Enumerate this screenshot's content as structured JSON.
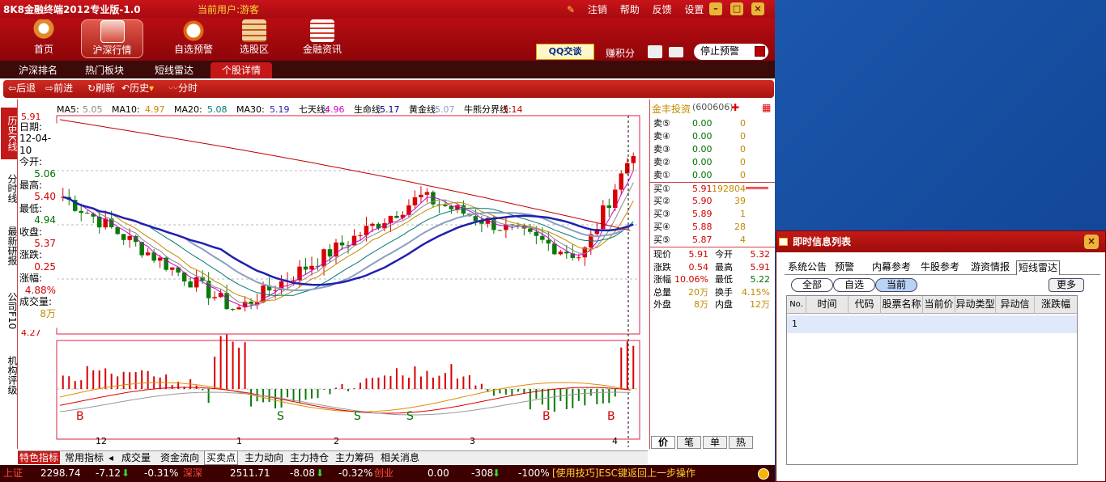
{
  "window": {
    "title": "8K8金融终端2012专业版-1.0",
    "user_label": "当前用户:游客",
    "menu": [
      "注销",
      "帮助",
      "反馈",
      "设置"
    ]
  },
  "toolbar": {
    "items": [
      "首页",
      "沪深行情",
      "自选预警",
      "选股区",
      "金融资讯"
    ],
    "qq_label": "QQ交谈",
    "points_label": "赚积分",
    "stop_alert_label": "停止预警"
  },
  "nav_tabs": [
    "沪深排名",
    "热门板块",
    "短线雷达",
    "个股详情"
  ],
  "sub_toolbar": [
    "后退",
    "前进",
    "刷新",
    "历史",
    "分时"
  ],
  "side_tabs": [
    "历史K线",
    "分时线",
    "最新研报",
    "公司F10",
    "机构评级"
  ],
  "ma_legend": [
    {
      "label": "MA5:",
      "value": "5.05",
      "color": "#888888"
    },
    {
      "label": "MA10:",
      "value": "4.97",
      "color": "#c28a00"
    },
    {
      "label": "MA20:",
      "value": "5.08",
      "color": "#007a6e"
    },
    {
      "label": "MA30:",
      "value": "5.19",
      "color": "#1f1fb0"
    },
    {
      "label": "七天线:",
      "value": "4.96",
      "color": "#d000d0"
    },
    {
      "label": "生命线:",
      "value": "5.17",
      "color": "#000080"
    },
    {
      "label": "黄金线:",
      "value": "5.07",
      "color": "#8aa0c0"
    },
    {
      "label": "牛熊分界线:",
      "value": "5.14",
      "color": "#c00000"
    }
  ],
  "price_axis": {
    "top": "5.91",
    "bottom": "4.27"
  },
  "info_box": [
    {
      "label": "日期:",
      "value": "12-04-10"
    },
    {
      "label": "今开:",
      "value": "5.06"
    },
    {
      "label": "最高:",
      "value": "5.40"
    },
    {
      "label": "最低:",
      "value": "4.94"
    },
    {
      "label": "收盘:",
      "value": "5.37"
    },
    {
      "label": "涨跌:",
      "value": "0.25"
    },
    {
      "label": "涨幅:",
      "value": "4.88%"
    },
    {
      "label": "成交量:",
      "value": "8万"
    }
  ],
  "chart_data": {
    "type": "candlestick",
    "x_tick_labels": [
      "12",
      "1",
      "2",
      "3",
      "4"
    ],
    "y_range": [
      4.27,
      5.91
    ],
    "bs_markers": [
      "B",
      "S",
      "S",
      "S",
      "B",
      "B"
    ]
  },
  "bottom_tabs": [
    "特色指标",
    "常用指标",
    "成交量",
    "资金流向",
    "买卖点",
    "主力动向",
    "主力持仓",
    "主力筹码",
    "相关消息"
  ],
  "quote": {
    "name": "金丰投资",
    "code": "(600606)",
    "asks": [
      {
        "label": "卖⑤",
        "price": "0.00",
        "vol": "0"
      },
      {
        "label": "卖④",
        "price": "0.00",
        "vol": "0"
      },
      {
        "label": "卖③",
        "price": "0.00",
        "vol": "0"
      },
      {
        "label": "卖②",
        "price": "0.00",
        "vol": "0"
      },
      {
        "label": "卖①",
        "price": "0.00",
        "vol": "0"
      }
    ],
    "bids": [
      {
        "label": "买①",
        "price": "5.91",
        "vol": "192804"
      },
      {
        "label": "买②",
        "price": "5.90",
        "vol": "39"
      },
      {
        "label": "买③",
        "price": "5.89",
        "vol": "1"
      },
      {
        "label": "买④",
        "price": "5.88",
        "vol": "28"
      },
      {
        "label": "买⑤",
        "price": "5.87",
        "vol": "4"
      }
    ],
    "stats": [
      {
        "l1": "现价",
        "v1": "5.91",
        "l2": "今开",
        "v2": "5.32"
      },
      {
        "l1": "涨跌",
        "v1": "0.54",
        "l2": "最高",
        "v2": "5.91"
      },
      {
        "l1": "涨幅",
        "v1": "10.06%",
        "l2": "最低",
        "v2": "5.22"
      },
      {
        "l1": "总量",
        "v1": "20万",
        "l2": "换手",
        "v2": "4.15%"
      },
      {
        "l1": "外盘",
        "v1": "8万",
        "l2": "内盘",
        "v2": "12万"
      }
    ],
    "tabs": [
      "价",
      "笔",
      "单",
      "热"
    ]
  },
  "status": {
    "sh_label": "上证",
    "sh_value": "2298.74",
    "sh_change": "-7.12",
    "sh_pct": "-0.31%",
    "sz_label": "深深",
    "sz_value": "2511.71",
    "sz_change": "-8.08",
    "sz_pct": "-0.32%",
    "cy_label": "创业",
    "cy_value": "0.00",
    "cy_change": "-308",
    "cy_pct": "-100%",
    "tip": "[使用技巧]ESC键返回上一步操作"
  },
  "popup": {
    "title": "即时信息列表",
    "tabs": [
      "系统公告",
      "预警",
      "内幕参考",
      "牛股参考",
      "游资情报",
      "短线雷达"
    ],
    "filters": [
      "全部",
      "自选",
      "当前"
    ],
    "more": "更多",
    "columns": [
      "No.",
      "时间",
      "代码",
      "股票名称",
      "当前价",
      "异动类型",
      "异动信息",
      "涨跌幅"
    ],
    "row_no": "1"
  }
}
